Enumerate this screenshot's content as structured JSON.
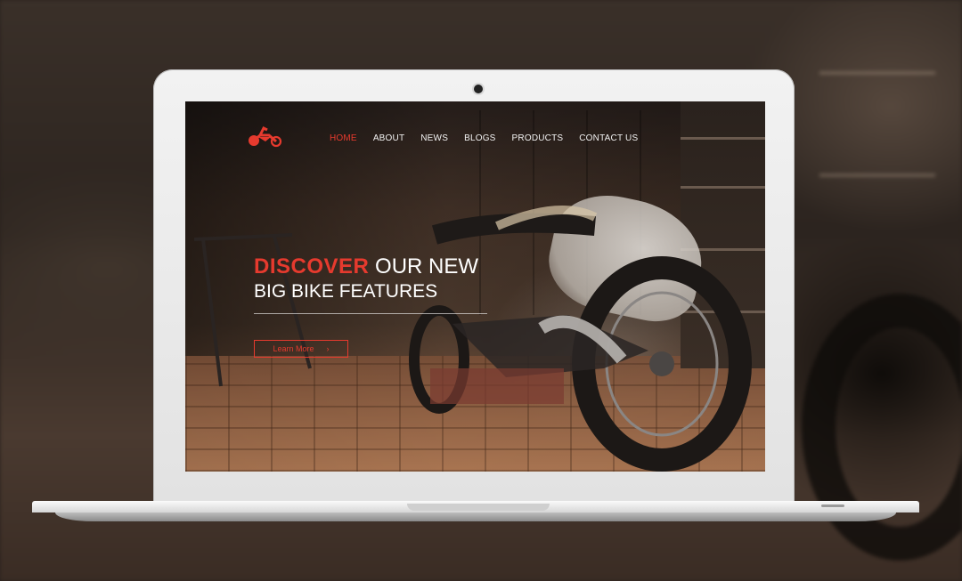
{
  "nav": {
    "items": [
      {
        "label": "HOME",
        "active": true
      },
      {
        "label": "ABOUT",
        "active": false
      },
      {
        "label": "NEWS",
        "active": false
      },
      {
        "label": "BLOGS",
        "active": false
      },
      {
        "label": "PRODUCTS",
        "active": false
      },
      {
        "label": "CONTACT US",
        "active": false
      }
    ],
    "logo_icon": "motorcycle-icon"
  },
  "hero": {
    "highlight": "DISCOVER",
    "title_rest": " OUR NEW",
    "subtitle": "BIG BIKE FEATURES",
    "cta_label": "Learn More",
    "cta_icon": "chevron-right-icon"
  },
  "colors": {
    "accent": "#e63a2e",
    "text": "#ffffff",
    "laptop": "#e8e8e8"
  }
}
